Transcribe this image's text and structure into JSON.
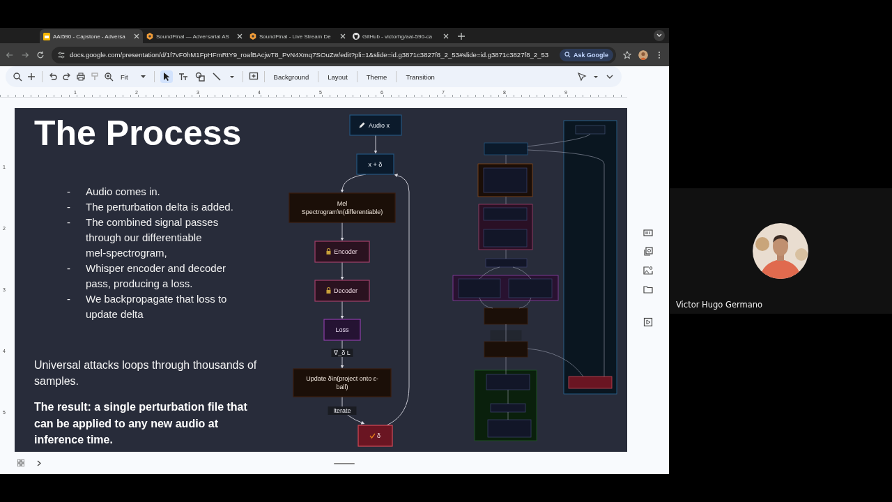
{
  "browser": {
    "tabs": [
      {
        "title": "AAI590 - Capstone - Adversa",
        "selected": true,
        "kind": "slides"
      },
      {
        "title": "SoundFinal — Adversarial AS",
        "selected": false,
        "kind": "app"
      },
      {
        "title": "SoundFinal - Live Stream De",
        "selected": false,
        "kind": "app"
      },
      {
        "title": "GitHub - victorhg/aai-590-ca",
        "selected": false,
        "kind": "github"
      }
    ],
    "url": "docs.google.com/presentation/d/1f7vF0hM1FpHFmRtY9_roafBAcjwT8_PvN4Xmq7SOuZw/edit?pli=1&slide=id.g3871c3827f8_2_53#slide=id.g3871c3827f8_2_53",
    "ask_button": "Ask Google"
  },
  "toolbar": {
    "zoom": "Fit",
    "tools": [
      {
        "kind": "select",
        "selected": true
      },
      {
        "kind": "text",
        "selected": false
      },
      {
        "kind": "shape",
        "selected": false
      },
      {
        "kind": "line",
        "selected": false
      }
    ],
    "menu_items": [
      "Background",
      "Layout",
      "Theme",
      "Transition"
    ]
  },
  "rulers": {
    "horizontal": [
      "1",
      "2",
      "3",
      "4",
      "5",
      "6",
      "7",
      "8",
      "9"
    ],
    "vertical": [
      "1",
      "2",
      "3",
      "4",
      "5"
    ]
  },
  "slide": {
    "title": "The Process",
    "bullets": [
      {
        "marker": "-",
        "text": "Audio comes in."
      },
      {
        "marker": "-",
        "text": "The perturbation delta is added."
      },
      {
        "marker": "-",
        "text": "The combined signal passes through our differentiable mel-spectrogram,"
      },
      {
        "marker": "-",
        "text": "Whisper encoder and decoder pass, producing a loss."
      },
      {
        "marker": "-",
        "text": "We backpropagate that loss to update delta"
      }
    ],
    "paragraph": "Universal attacks loops through thousands of samples.",
    "result": "The result:  a single perturbation file that can be applied to any new audio at inference time.",
    "flowchart": {
      "nodes": [
        {
          "lines": [
            "Audio x"
          ],
          "kind": "input"
        },
        {
          "lines": [
            "x + δ"
          ],
          "kind": "input"
        },
        {
          "lines": [
            "Mel",
            "Spectrogram\\n(differentiable)"
          ],
          "kind": "process"
        },
        {
          "lines": [
            "Encoder"
          ],
          "kind": "model"
        },
        {
          "lines": [
            "Decoder"
          ],
          "kind": "model"
        },
        {
          "lines": [
            "Loss"
          ],
          "kind": "loss"
        },
        {
          "lines": [
            "Update δ\\n(project onto ε-",
            "ball)"
          ],
          "kind": "process"
        },
        {
          "lines": [
            "δ"
          ],
          "kind": "output"
        }
      ],
      "edge_labels": [
        "∇_δ L",
        "iterate"
      ]
    }
  },
  "participant": {
    "name": "Victor Hugo Germano"
  }
}
